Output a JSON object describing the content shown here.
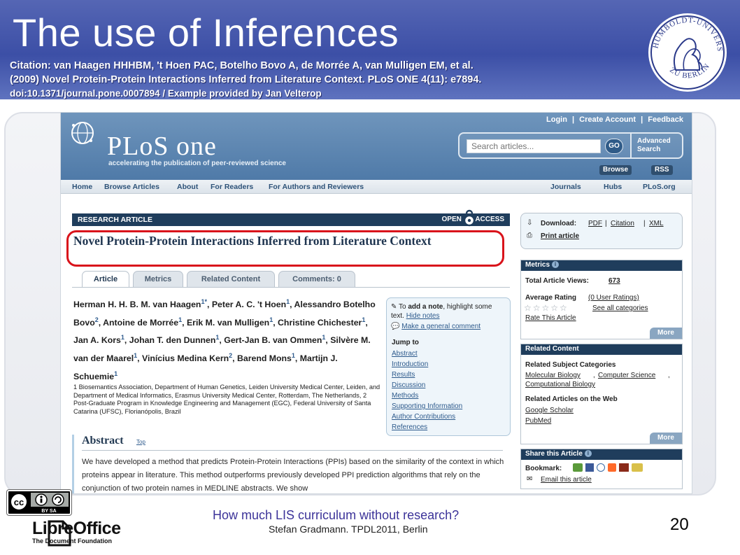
{
  "slide": {
    "title": "The use of Inferences",
    "citation_line1": "Citation: van Haagen HHHBM, 't Hoen PAC, Botelho Bovo A, de Morrée A, van Mulligen EM, et al.",
    "citation_line2": "(2009) Novel Protein-Protein Interactions Inferred from Literature Context. PLoS ONE 4(11): e7894.",
    "citation_line3": "doi:10.1371/journal.pone.0007894  / Example  provided by Jan Velterop",
    "seal_text_top": "HUMBOLDT-UNIVERSITÄT",
    "seal_text_bottom": "ZU BERLIN",
    "footer_question": "How much LIS curriculum without research?",
    "footer_author": "Stefan Gradmann. TPDL2011, Berlin",
    "page_number": "20",
    "cc_label": "BY  SA",
    "libreoffice_word": "LibreOffice",
    "libreoffice_sub": "The Document Foundation"
  },
  "plos": {
    "top_links": [
      "Login",
      "|",
      "Create Account",
      "|",
      "Feedback"
    ],
    "logo_text": "PLoS one",
    "tagline": "accelerating the publication of peer-reviewed science",
    "search_placeholder": "Search articles...",
    "go_label": "GO",
    "advanced_search": "Advanced Search",
    "browse_label": "Browse",
    "rss_label": "RSS",
    "nav_left": [
      "Home",
      "Browse Articles",
      "About",
      "For Readers",
      "For Authors and Reviewers"
    ],
    "nav_right": [
      "Journals",
      "Hubs",
      "PLoS.org"
    ]
  },
  "article": {
    "section_label": "RESEARCH ARTICLE",
    "open_label": "OPEN",
    "access_label": "ACCESS",
    "title": "Novel Protein-Protein Interactions Inferred from Literature Context",
    "tabs": [
      "Article",
      "Metrics",
      "Related Content",
      "Comments: 0"
    ],
    "authors_html_parts": [
      [
        "Herman H. H. B. M. van Haagen",
        "1*"
      ],
      [
        "Peter A. C. 't Hoen",
        "1"
      ],
      [
        "Alessandro Botelho Bovo",
        "2"
      ],
      [
        "Antoine de Morrée",
        "1"
      ],
      [
        "Erik M. van Mulligen",
        "1"
      ],
      [
        "Christine Chichester",
        "1"
      ],
      [
        "Jan A. Kors",
        "1"
      ],
      [
        "Johan T. den Dunnen",
        "1"
      ],
      [
        "Gert-Jan B. van Ommen",
        "1"
      ],
      [
        "Silvère M. van der Maarel",
        "1"
      ],
      [
        "Vinícius Medina Kern",
        "2"
      ],
      [
        "Barend Mons",
        "1"
      ],
      [
        "Martijn J. Schuemie",
        "1"
      ]
    ],
    "affiliations": "1 Biosemantics Association, Department of Human Genetics, Leiden University Medical Center, Leiden, and Department of Medical Informatics, Erasmus University Medical Center, Rotterdam, The Netherlands, 2 Post-Graduate Program in Knowledge Engineering and Management (EGC), Federal University of Santa Catarina (UFSC), Florianópolis, Brazil",
    "notes": {
      "add_note_prefix": "To ",
      "add_note_bold": "add a note",
      "add_note_suffix": ", highlight some text.",
      "hide_notes": "Hide notes",
      "general_comment": "Make a general comment",
      "jump_to": "Jump to",
      "jump_links": [
        "Abstract",
        "Introduction",
        "Results",
        "Discussion",
        "Methods",
        "Supporting Information",
        "Author Contributions",
        "References"
      ]
    },
    "abstract_heading": "Abstract",
    "abstract_top": "Top",
    "abstract_text": "We have developed a method that predicts Protein-Protein Interactions (PPIs) based on the similarity of the context in which proteins appear in literature. This method outperforms previously developed PPI prediction algorithms that rely on the conjunction of two protein names in MEDLINE abstracts. We show"
  },
  "sidebar": {
    "download_label": "Download:",
    "download_links": [
      "PDF",
      "Citation",
      "XML"
    ],
    "print_article": "Print article",
    "metrics_header": "Metrics",
    "total_views_label": "Total Article Views:",
    "total_views": "673",
    "avg_rating_label": "Average Rating",
    "user_ratings": "(0 User Ratings)",
    "see_all": "See all categories",
    "rate_article": "Rate This Article",
    "more": "More",
    "related_header": "Related Content",
    "related_subj_label": "Related Subject Categories",
    "subject_links": [
      "Molecular Biology",
      "Computer Science",
      "Computational Biology"
    ],
    "related_web_label": "Related Articles on the Web",
    "web_links": [
      "Google Scholar",
      "PubMed"
    ],
    "share_header": "Share this Article",
    "bookmark_label": "Bookmark:",
    "email_article": "Email this article"
  }
}
